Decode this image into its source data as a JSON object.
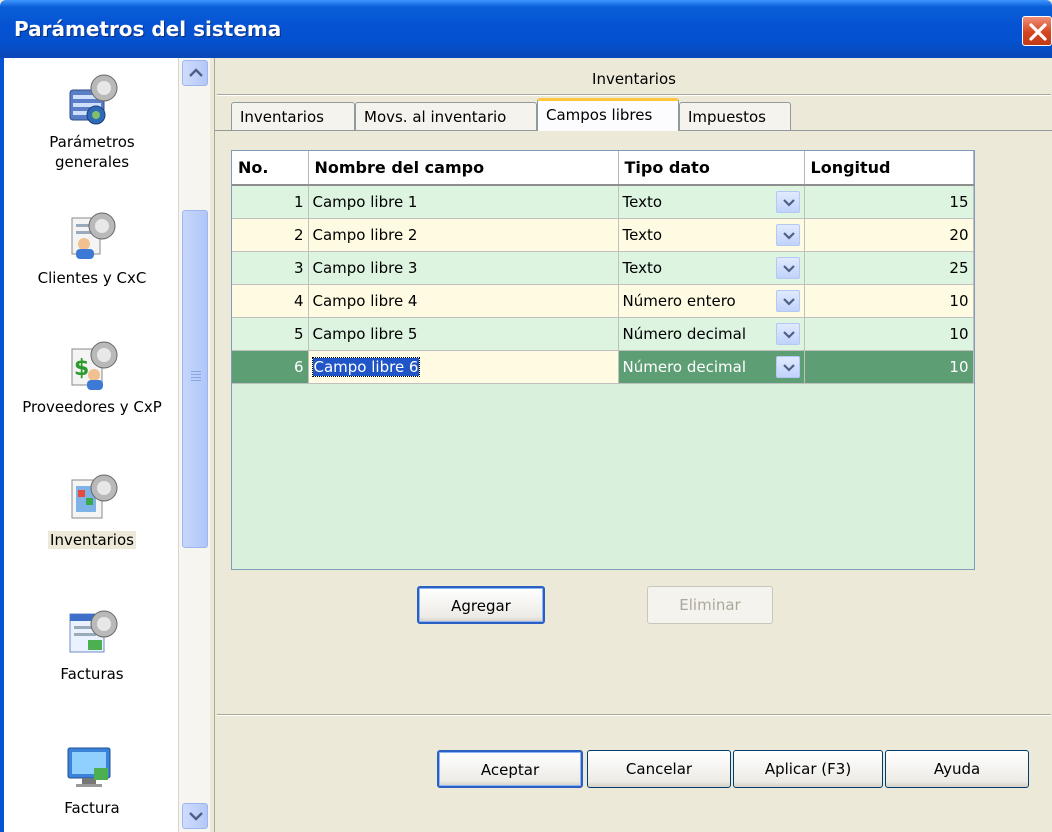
{
  "window": {
    "title": "Parámetros del sistema"
  },
  "sidebar": {
    "items": [
      {
        "label": "Parámetros generales",
        "icon": "system-parameters-icon"
      },
      {
        "label": "Clientes y CxC",
        "icon": "clients-icon"
      },
      {
        "label": "Proveedores y CxP",
        "icon": "suppliers-icon"
      },
      {
        "label": "Inventarios",
        "icon": "inventory-icon",
        "selected": true
      },
      {
        "label": "Facturas",
        "icon": "invoices-icon"
      },
      {
        "label": "Factura",
        "icon": "invoice-monitor-icon"
      }
    ]
  },
  "panel": {
    "title": "Inventarios"
  },
  "tabs": [
    {
      "label": "Inventarios"
    },
    {
      "label": "Movs. al inventario"
    },
    {
      "label": "Campos libres",
      "active": true
    },
    {
      "label": "Impuestos"
    }
  ],
  "grid": {
    "headers": {
      "no": "No.",
      "name": "Nombre del campo",
      "type": "Tipo dato",
      "length": "Longitud"
    },
    "rows": [
      {
        "no": "1",
        "name": "Campo libre 1",
        "type": "Texto",
        "length": "15"
      },
      {
        "no": "2",
        "name": "Campo libre 2",
        "type": "Texto",
        "length": "20"
      },
      {
        "no": "3",
        "name": "Campo libre 3",
        "type": "Texto",
        "length": "25"
      },
      {
        "no": "4",
        "name": "Campo libre 4",
        "type": "Número entero",
        "length": "10"
      },
      {
        "no": "5",
        "name": "Campo libre 5",
        "type": "Número decimal",
        "length": "10"
      },
      {
        "no": "6",
        "name": "Campo libre 6",
        "type": "Número decimal",
        "length": "10"
      }
    ]
  },
  "actions": {
    "add": "Agregar",
    "remove": "Eliminar"
  },
  "footer": {
    "ok": "Aceptar",
    "cancel": "Cancelar",
    "apply": "Aplicar (F3)",
    "help": "Ayuda"
  },
  "colors": {
    "titlebar": "#0553d3",
    "row_green": "#dcf4e0",
    "row_yellow": "#fffbe3",
    "row_selected": "#5e9e75"
  }
}
